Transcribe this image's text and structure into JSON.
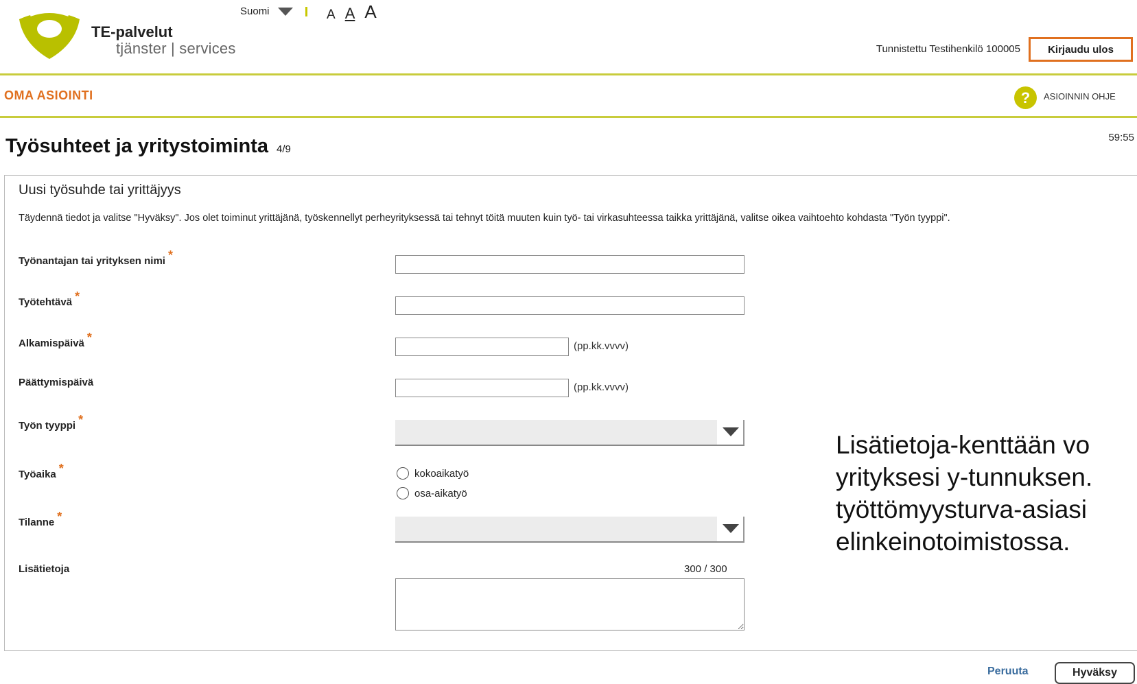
{
  "header": {
    "brand_name": "TE-palvelut",
    "brand_sub": "tjänster | services",
    "language": "Suomi",
    "font_size_small": "A",
    "font_size_medium": "A",
    "font_size_large": "A",
    "user_name": "Tunnistettu Testihenkilö 100005",
    "logout_label": "Kirjaudu ulos"
  },
  "nav": {
    "section_name": "OMA ASIOINTI",
    "help_icon_glyph": "?",
    "help_label": "ASIOINNIN OHJE"
  },
  "page": {
    "title": "Työsuhteet ja yritystoiminta",
    "step": "4/9",
    "timer": "59:55"
  },
  "form": {
    "title": "Uusi työsuhde tai yrittäjyys",
    "description": "Täydennä tiedot ja valitse \"Hyväksy\". Jos olet toiminut yrittäjänä, työskennellyt perheyrityksessä tai tehnyt töitä muuten kuin työ- tai virkasuhteessa taikka yrittäjänä, valitse oikea vaihtoehto kohdasta \"Työn tyyppi\".",
    "required_marker": "*",
    "fields": {
      "employer": {
        "label": "Työnantajan tai yrityksen nimi",
        "value": ""
      },
      "task": {
        "label": "Työtehtävä",
        "value": ""
      },
      "start_date": {
        "label": "Alkamispäivä",
        "value": "",
        "hint": "(pp.kk.vvvv)"
      },
      "end_date": {
        "label": "Päättymispäivä",
        "value": "",
        "hint": "(pp.kk.vvvv)"
      },
      "work_type": {
        "label": "Työn tyyppi",
        "selected": ""
      },
      "working_time": {
        "label": "Työaika",
        "options": [
          "kokoaikatyö",
          "osa-aikatyö"
        ]
      },
      "situation": {
        "label": "Tilanne",
        "selected": ""
      },
      "additional_info": {
        "label": "Lisätietoja",
        "counter": "300 / 300",
        "value": ""
      }
    }
  },
  "callout": {
    "lines": [
      "Lisätietoja-kenttään vo",
      "yrityksesi y-tunnuksen.",
      "työttömyysturva-asiasi",
      "elinkeinotoimistossa."
    ]
  },
  "footer": {
    "cancel_label": "Peruuta",
    "accept_label": "Hyväksy"
  },
  "colors": {
    "accent_orange": "#e0701f",
    "brand_green": "#c8cc3c",
    "link_blue": "#3a6c9e"
  }
}
